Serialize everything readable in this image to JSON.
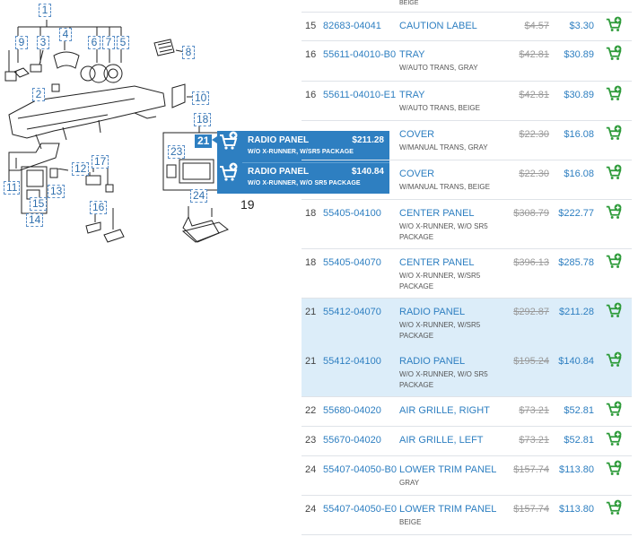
{
  "diagram": {
    "callouts": [
      "1",
      "9",
      "3",
      "4",
      "6",
      "7",
      "5",
      "8",
      "2",
      "10",
      "18",
      "21",
      "23",
      "12",
      "17",
      "11",
      "13",
      "15",
      "14",
      "16",
      "24"
    ],
    "plain_label": "19",
    "popup": {
      "items": [
        {
          "name": "RADIO PANEL",
          "price": "$211.28",
          "desc": "W/O X-RUNNER, W/SR5 PACKAGE"
        },
        {
          "name": "RADIO PANEL",
          "price": "$140.84",
          "desc": "W/O X-RUNNER, W/O SR5 PACKAGE"
        }
      ]
    }
  },
  "parts": {
    "top_cut_text": "BEIGE",
    "rows": [
      {
        "num": "15",
        "pn": "82683-04041",
        "name": "CAUTION LABEL",
        "desc": [],
        "old": "$4.57",
        "price": "$3.30"
      },
      {
        "num": "16",
        "pn": "55611-04010-B0",
        "name": "TRAY",
        "desc": [
          "W/AUTO TRANS, GRAY"
        ],
        "old": "$42.81",
        "price": "$30.89"
      },
      {
        "num": "16",
        "pn": "55611-04010-E1",
        "name": "TRAY",
        "desc": [
          "W/AUTO TRANS, BEIGE"
        ],
        "old": "$42.81",
        "price": "$30.89"
      },
      {
        "num": "",
        "pn": "",
        "name": "COVER",
        "desc": [
          "W/MANUAL TRANS, GRAY"
        ],
        "old": "$22.30",
        "price": "$16.08"
      },
      {
        "num": "",
        "pn": "",
        "name": "COVER",
        "desc": [
          "W/MANUAL TRANS, BEIGE"
        ],
        "old": "$22.30",
        "price": "$16.08"
      },
      {
        "num": "18",
        "pn": "55405-04100",
        "name": "CENTER PANEL",
        "desc": [
          "W/O X-RUNNER, W/O SR5",
          "PACKAGE"
        ],
        "old": "$308.79",
        "price": "$222.77"
      },
      {
        "num": "18",
        "pn": "55405-04070",
        "name": "CENTER PANEL",
        "desc": [
          "W/O X-RUNNER, W/SR5",
          "PACKAGE"
        ],
        "old": "$396.13",
        "price": "$285.78"
      },
      {
        "num": "21",
        "pn": "55412-04070",
        "name": "RADIO PANEL",
        "desc": [
          "W/O X-RUNNER, W/SR5",
          "PACKAGE"
        ],
        "old": "$292.87",
        "price": "$211.28"
      },
      {
        "num": "21",
        "pn": "55412-04100",
        "name": "RADIO PANEL",
        "desc": [
          "W/O X-RUNNER, W/O SR5",
          "PACKAGE"
        ],
        "old": "$195.24",
        "price": "$140.84"
      },
      {
        "num": "22",
        "pn": "55680-04020",
        "name": "AIR GRILLE, RIGHT",
        "desc": [],
        "old": "$73.21",
        "price": "$52.81"
      },
      {
        "num": "23",
        "pn": "55670-04020",
        "name": "AIR GRILLE, LEFT",
        "desc": [],
        "old": "$73.21",
        "price": "$52.81"
      },
      {
        "num": "24",
        "pn": "55407-04050-B0",
        "name": "LOWER TRIM PANEL",
        "desc": [
          "GRAY"
        ],
        "old": "$157.74",
        "price": "$113.80"
      },
      {
        "num": "24",
        "pn": "55407-04050-E0",
        "name": "LOWER TRIM PANEL",
        "desc": [
          "BEIGE"
        ],
        "old": "$157.74",
        "price": "$113.80"
      }
    ]
  },
  "colors": {
    "accent": "#2e7fc1",
    "highlight": "#dcedf9",
    "cart_green": "#2e9b3a",
    "strike_gray": "#9a9a9a"
  },
  "icons": {
    "add_to_cart": "cart-plus-icon"
  }
}
